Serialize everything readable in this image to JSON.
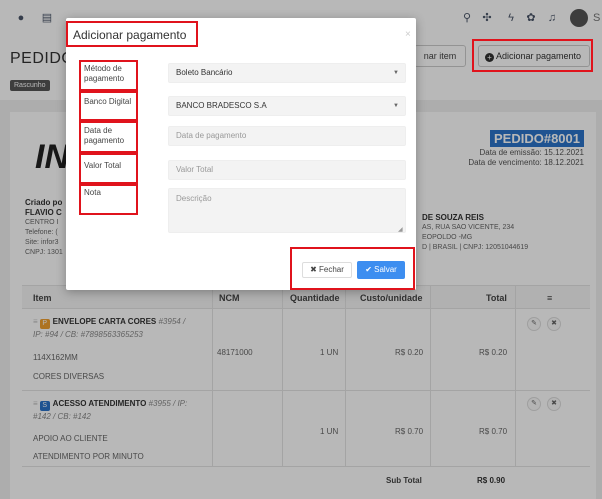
{
  "topbar": {
    "icons": [
      "info-circle-icon",
      "table-icon",
      "globe-icon",
      "app-icon",
      "search-icon",
      "sliders-icon",
      "bolt-icon",
      "gear-icon",
      "bell-icon",
      "mail-icon"
    ],
    "user_initial": "S"
  },
  "header": {
    "title": "PEDIDO",
    "status": "Rascunho",
    "add_item_label": "nar item",
    "add_payment_label": "Adicionar pagamento"
  },
  "document": {
    "logo_text": "IN",
    "order_number": "PEDIDO#8001",
    "emission_date": "Data de emissão: 15.12.2021",
    "due_date": "Data de vencimento: 18.12.2021",
    "created_by_label": "Criado po",
    "seller_name": "FLAVIO C",
    "seller_lines": [
      "CENTRO I",
      "Telefone: (",
      "Site: infor3",
      "CNPJ: 1301"
    ],
    "client_name": "DE SOUZA REIS",
    "client_lines": [
      "AS, RUA SAO VICENTE, 234",
      "EOPOLDO -MG",
      "D | BRASIL | CNPJ: 12051044619"
    ]
  },
  "table": {
    "headers": {
      "item": "Item",
      "ncm": "NCM",
      "qty": "Quantidade",
      "unit_cost": "Custo/unidade",
      "total": "Total",
      "menu": "≡"
    },
    "rows": [
      {
        "tag": "P",
        "name": "ENVELOPE CARTA CORES",
        "meta_line1": "#3954 /",
        "meta_line2": "IP: #94 / CB: #7898563365253",
        "sub1": "114X162MM",
        "sub2": "CORES DIVERSAS",
        "ncm": "48171000",
        "qty": "1 UN",
        "unit_cost": "R$ 0.20",
        "total": "R$ 0.20"
      },
      {
        "tag": "S",
        "name": "ACESSO ATENDIMENTO",
        "meta_line1": "#3955 / IP:",
        "meta_line2": "#142 / CB: #142",
        "sub1": "APOIO AO CLIENTE",
        "sub2": "ATENDIMENTO POR MINUTO",
        "ncm": "",
        "qty": "1 UN",
        "unit_cost": "R$ 0.70",
        "total": "R$ 0.70"
      }
    ],
    "subtotal_label": "Sub Total",
    "subtotal_value": "R$ 0.90"
  },
  "modal": {
    "title": "Adicionar pagamento",
    "close_symbol": "×",
    "fields": {
      "method_label": "Método de pagamento",
      "method_value": "Boleto Bancário",
      "bank_label": "Banco Digital",
      "bank_value": "BANCO BRADESCO S.A",
      "date_label": "Data de pagamento",
      "date_placeholder": "Data de pagamento",
      "total_label": "Valor Total",
      "total_placeholder": "Valor Total",
      "note_label": "Nota",
      "note_placeholder": "Descrição"
    },
    "close_button": "Fechar",
    "save_button": "Salvar"
  },
  "colors": {
    "highlight": "#e0131c",
    "primary": "#3d8ef0",
    "order_badge": "#2b74c9",
    "tag_product": "#f0a030",
    "tag_service": "#2b74c9"
  }
}
